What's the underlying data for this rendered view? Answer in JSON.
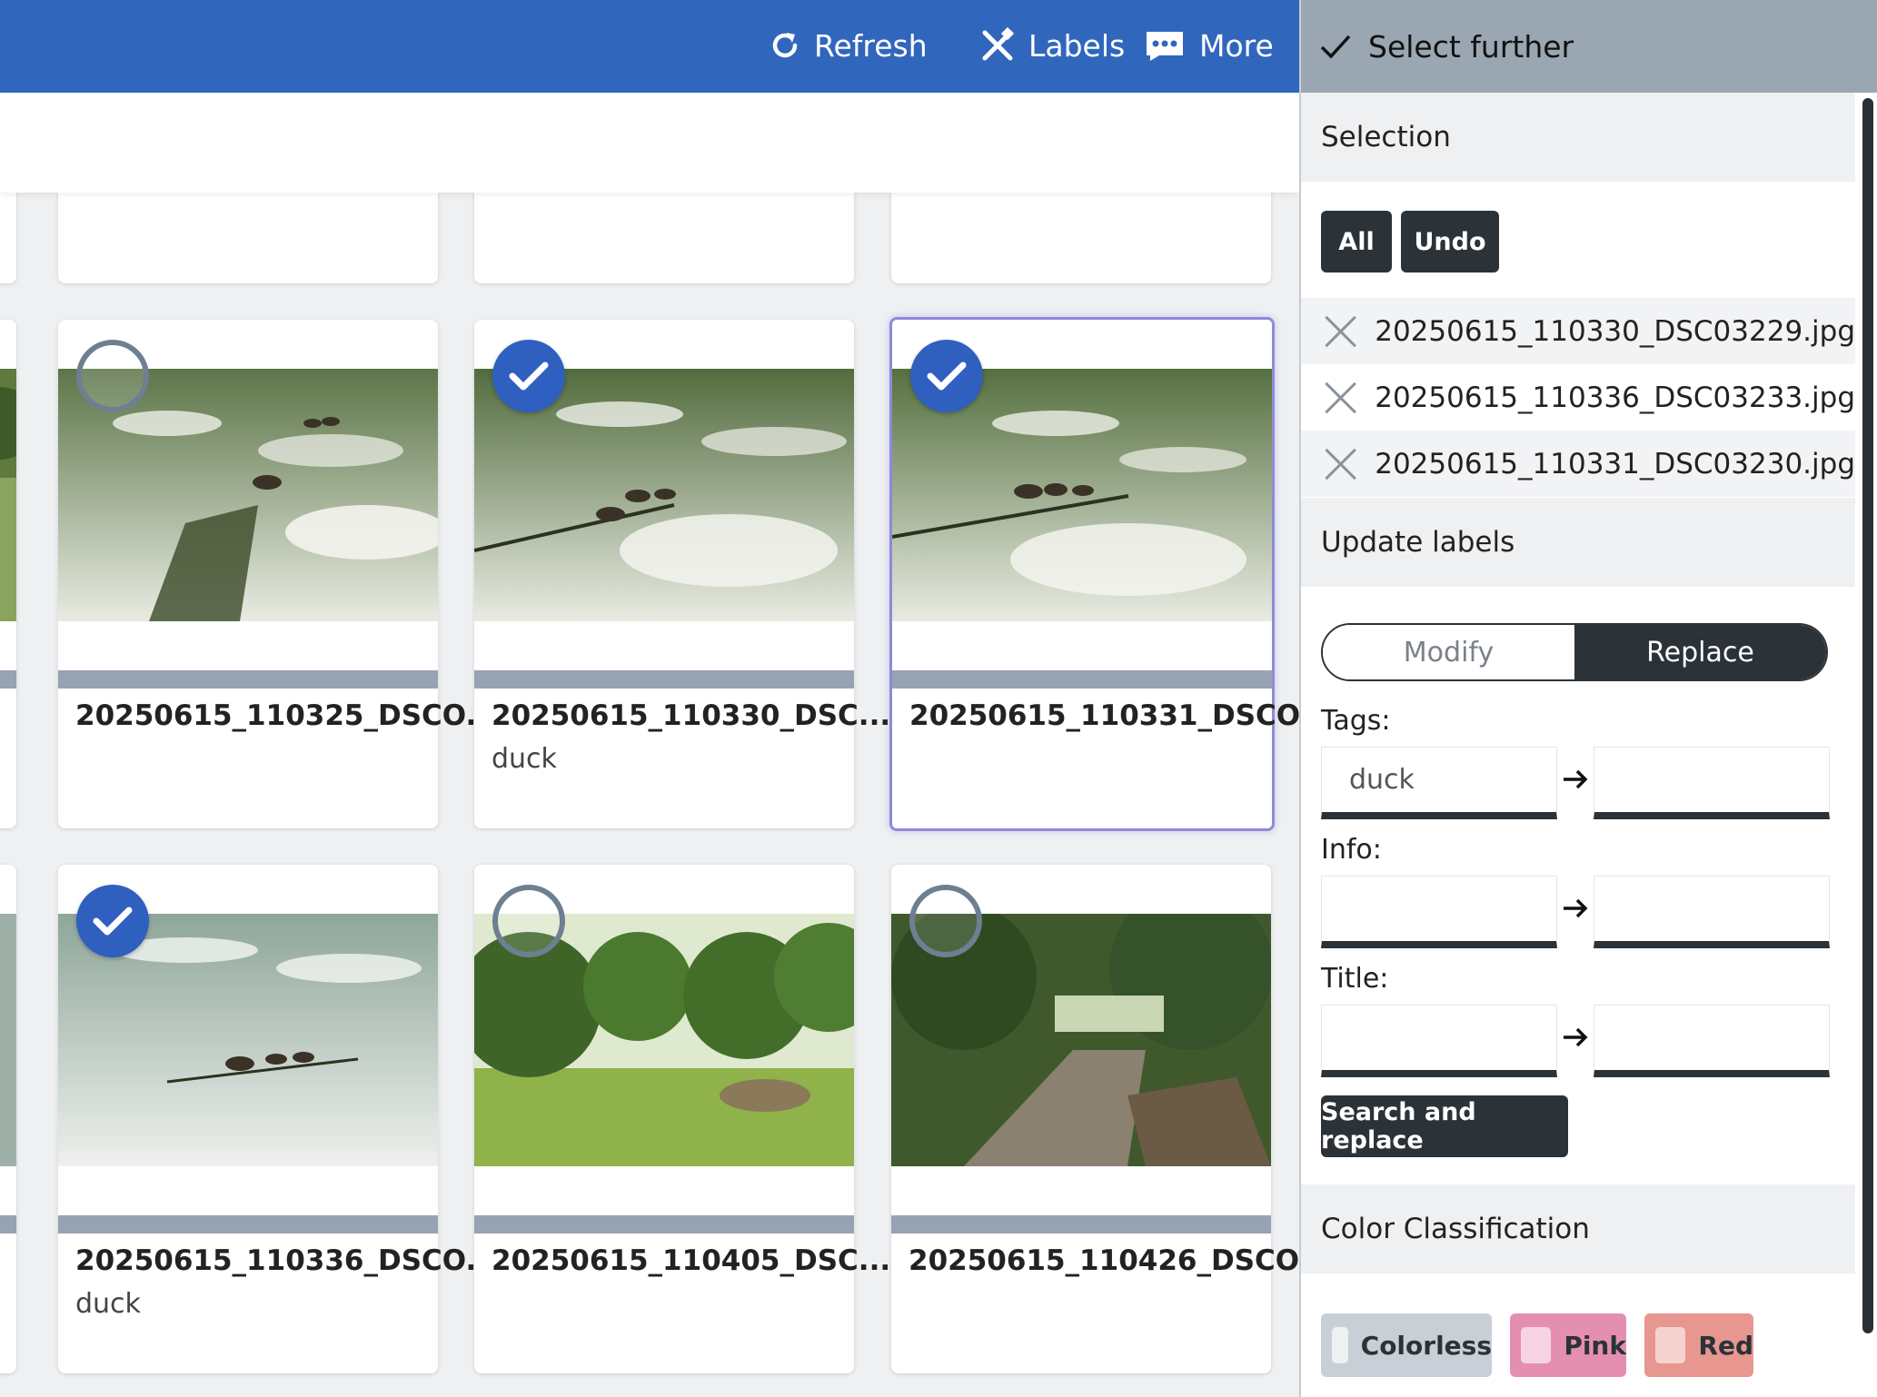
{
  "toolbar": {
    "refresh_label": "Refresh",
    "labels_label": "Labels",
    "more_label": "More"
  },
  "grid": {
    "cards": [
      {
        "name": "20250615_110325_DSCO...",
        "label": "",
        "selected": false
      },
      {
        "name": "20250615_110330_DSC...",
        "label": "duck",
        "selected": true
      },
      {
        "name": "20250615_110331_DSCO...",
        "label": "",
        "selected": true
      },
      {
        "name": "20250615_110336_DSCO...",
        "label": "duck",
        "selected": true
      },
      {
        "name": "20250615_110405_DSC...",
        "label": "",
        "selected": false
      },
      {
        "name": "20250615_110426_DSCO...",
        "label": "",
        "selected": false
      }
    ]
  },
  "panel": {
    "header": "Select further",
    "selection_title": "Selection",
    "all_button": "All",
    "undo_button": "Undo",
    "files": [
      "20250615_110330_DSC03229.jpg",
      "20250615_110336_DSC03233.jpg",
      "20250615_110331_DSC03230.jpg"
    ],
    "update_labels_title": "Update labels",
    "modify_label": "Modify",
    "replace_label": "Replace",
    "tags_label": "Tags:",
    "tags_from": "duck",
    "tags_to": "",
    "info_label": "Info:",
    "info_from": "",
    "info_to": "",
    "title_label": "Title:",
    "title_from": "",
    "title_to": "",
    "search_replace_button": "Search and replace",
    "color_title": "Color Classification",
    "colors": [
      {
        "label": "Colorless",
        "bg": "#c9cfd6",
        "swatch": "#eef0f2"
      },
      {
        "label": "Pink",
        "bg": "#e58fb0",
        "swatch": "#f6d3e0"
      },
      {
        "label": "Red",
        "bg": "#e79690",
        "swatch": "#f6d2cf"
      }
    ]
  }
}
